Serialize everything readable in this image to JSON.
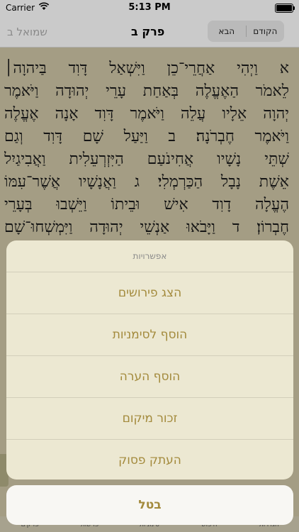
{
  "status_bar": {
    "carrier": "Carrier",
    "time": "5:13 PM"
  },
  "nav": {
    "book": "שמואל ב",
    "chapter": "פרק ב",
    "prev_label": "הקודם",
    "next_label": "הבא"
  },
  "verse_lines": [
    "א וַיְהִי אַחֲרֵי־כֵן וַיִּשְׁאַל דָּוִד בַּיהוָה׀",
    "לֵאמֹר הַאֶעֱלֶה בְּאַחַת עָרֵי יְהוּדָה וַיֹּאמֶר",
    "יְהוָה אֵלָיו עֲלֵה וַיֹּאמֶר דָּוִד אָנָה אֶעֱלֶה",
    "וַיֹּאמֶר חֶבְרֹנָה׃ ב וַיַּעַל שָׁם דָּוִד וְגַם",
    "שְׁתֵּי נָשָׁיו אֲחִינֹעַם הַיִּזְרְעֵלִית וַאֲבִיגַיִל",
    "אֵשֶׁת נָבָל הַכַּרְמְלִי׃ ג וַאֲנָשָׁיו אֲשֶׁר־עִמּוֹ",
    "הֶעֱלָה דָוִד אִישׁ וּבֵיתוֹ וַיֵּשְׁבוּ בְּעָרֵי",
    "חֶבְרוֹן׃ ד וַיָּבֹאוּ אַנְשֵׁי יְהוּדָה וַיִּמְשְׁחוּ־שָׁם"
  ],
  "action_sheet": {
    "title": "אפשרויות",
    "items": [
      "הצג פירושים",
      "הוסף לסימניות",
      "הוסף הערה",
      "זכור מיקום",
      "העתק פסוק"
    ],
    "cancel": "בטל"
  },
  "tabbar": {
    "items": [
      "הגדרות",
      "חיפוש",
      "סימניות",
      "פרשות",
      "פרקים"
    ]
  },
  "colors": {
    "accent": "#a38a3c",
    "parchment": "#c8c0a2",
    "sheet": "#ece8d2"
  }
}
